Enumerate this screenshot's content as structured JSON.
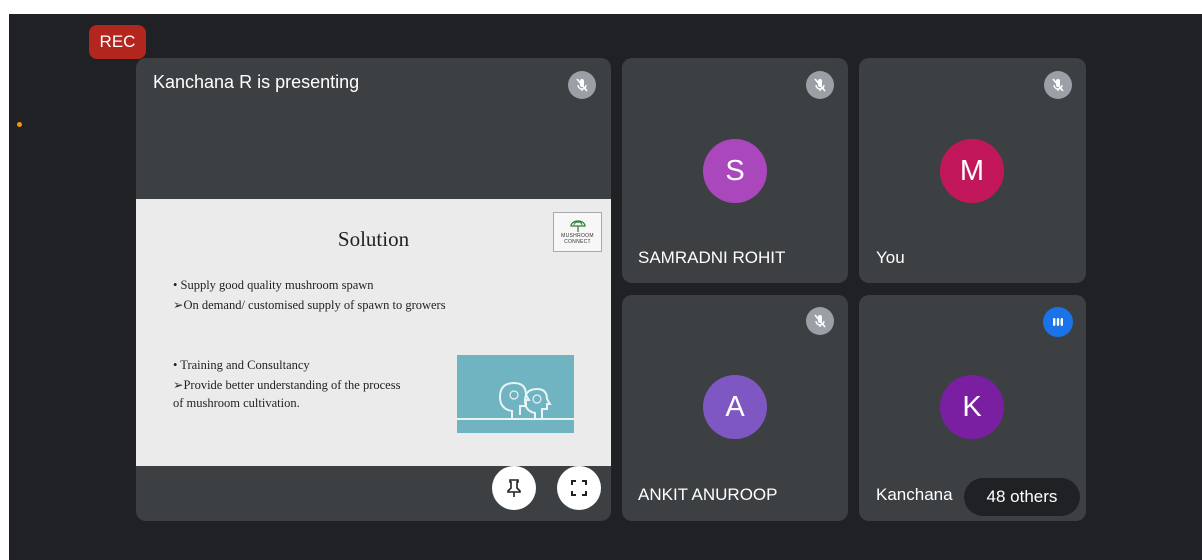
{
  "recording_badge": "REC",
  "presentation": {
    "title": "Kanchana R is presenting",
    "slide": {
      "title": "Solution",
      "logo_text_1": "MUSHROOM",
      "logo_text_2": "CONNECT",
      "lines": [
        "• Supply good quality mushroom spawn",
        "➢On demand/ customised supply of spawn to growers",
        "• Training and Consultancy",
        "➢Provide better understanding of the process",
        "of mushroom cultivation."
      ]
    },
    "pin_icon": "pin-icon",
    "fullscreen_icon": "fullscreen-icon"
  },
  "participants": [
    {
      "initial": "S",
      "name": "SAMRADNI ROHIT",
      "avatar_color": "#ab47bc",
      "status": "muted"
    },
    {
      "initial": "M",
      "name": "You",
      "avatar_color": "#c2185b",
      "status": "muted"
    },
    {
      "initial": "A",
      "name": "ANKIT ANUROOP",
      "avatar_color": "#7e57c2",
      "status": "muted"
    },
    {
      "initial": "K",
      "name": "Kanchana",
      "avatar_color": "#7b1fa2",
      "status": "speaking"
    }
  ],
  "others_label": "48 others",
  "colors": {
    "background": "#202124",
    "tile": "#3c4043",
    "rec": "#b3261e",
    "speaking": "#1a73e8",
    "mute_badge": "#9aa0a6"
  }
}
